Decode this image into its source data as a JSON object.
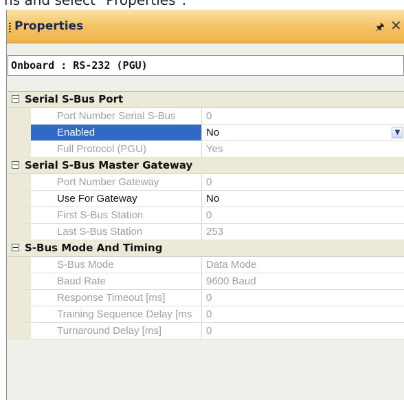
{
  "caption": "ns and select \"Properties\".",
  "panel": {
    "title": "Properties",
    "pin_glyph": "Ն",
    "close_glyph": "✕",
    "object_label": "Onboard : RS-232 (PGU)"
  },
  "categories": [
    {
      "label": "Serial S-Bus Port",
      "properties": [
        {
          "name": "Port Number Serial S-Bus",
          "value": "0",
          "readonly": true
        },
        {
          "name": "Enabled",
          "value": "No",
          "readonly": false,
          "selected": true,
          "dropdown": true
        },
        {
          "name": "Full Protocol (PGU)",
          "value": "Yes",
          "readonly": true
        }
      ]
    },
    {
      "label": "Serial S-Bus Master Gateway",
      "properties": [
        {
          "name": "Port Number Gateway",
          "value": "0",
          "readonly": true
        },
        {
          "name": "Use For Gateway",
          "value": "No",
          "readonly": false
        },
        {
          "name": "First S-Bus Station",
          "value": "0",
          "readonly": true
        },
        {
          "name": "Last S-Bus Station",
          "value": "253",
          "readonly": true
        }
      ]
    },
    {
      "label": "S-Bus Mode And Timing",
      "properties": [
        {
          "name": "S-Bus Mode",
          "value": "Data Mode",
          "readonly": true
        },
        {
          "name": "Baud Rate",
          "value": "9600 Baud",
          "readonly": true
        },
        {
          "name": "Response Timeout [ms]",
          "value": "0",
          "readonly": true
        },
        {
          "name": "Training Sequence Delay [ms",
          "value": "0",
          "readonly": true
        },
        {
          "name": "Turnaround Delay [ms]",
          "value": "0",
          "readonly": true
        }
      ]
    }
  ],
  "icons": {
    "collapse": "minus-box-icon",
    "dropdown": "chevron-down-icon",
    "pin": "pin-icon",
    "close": "close-icon"
  },
  "colors": {
    "title_bar": "#f4c467",
    "selection": "#3169c6",
    "readonly_text": "#a0a0a0"
  }
}
